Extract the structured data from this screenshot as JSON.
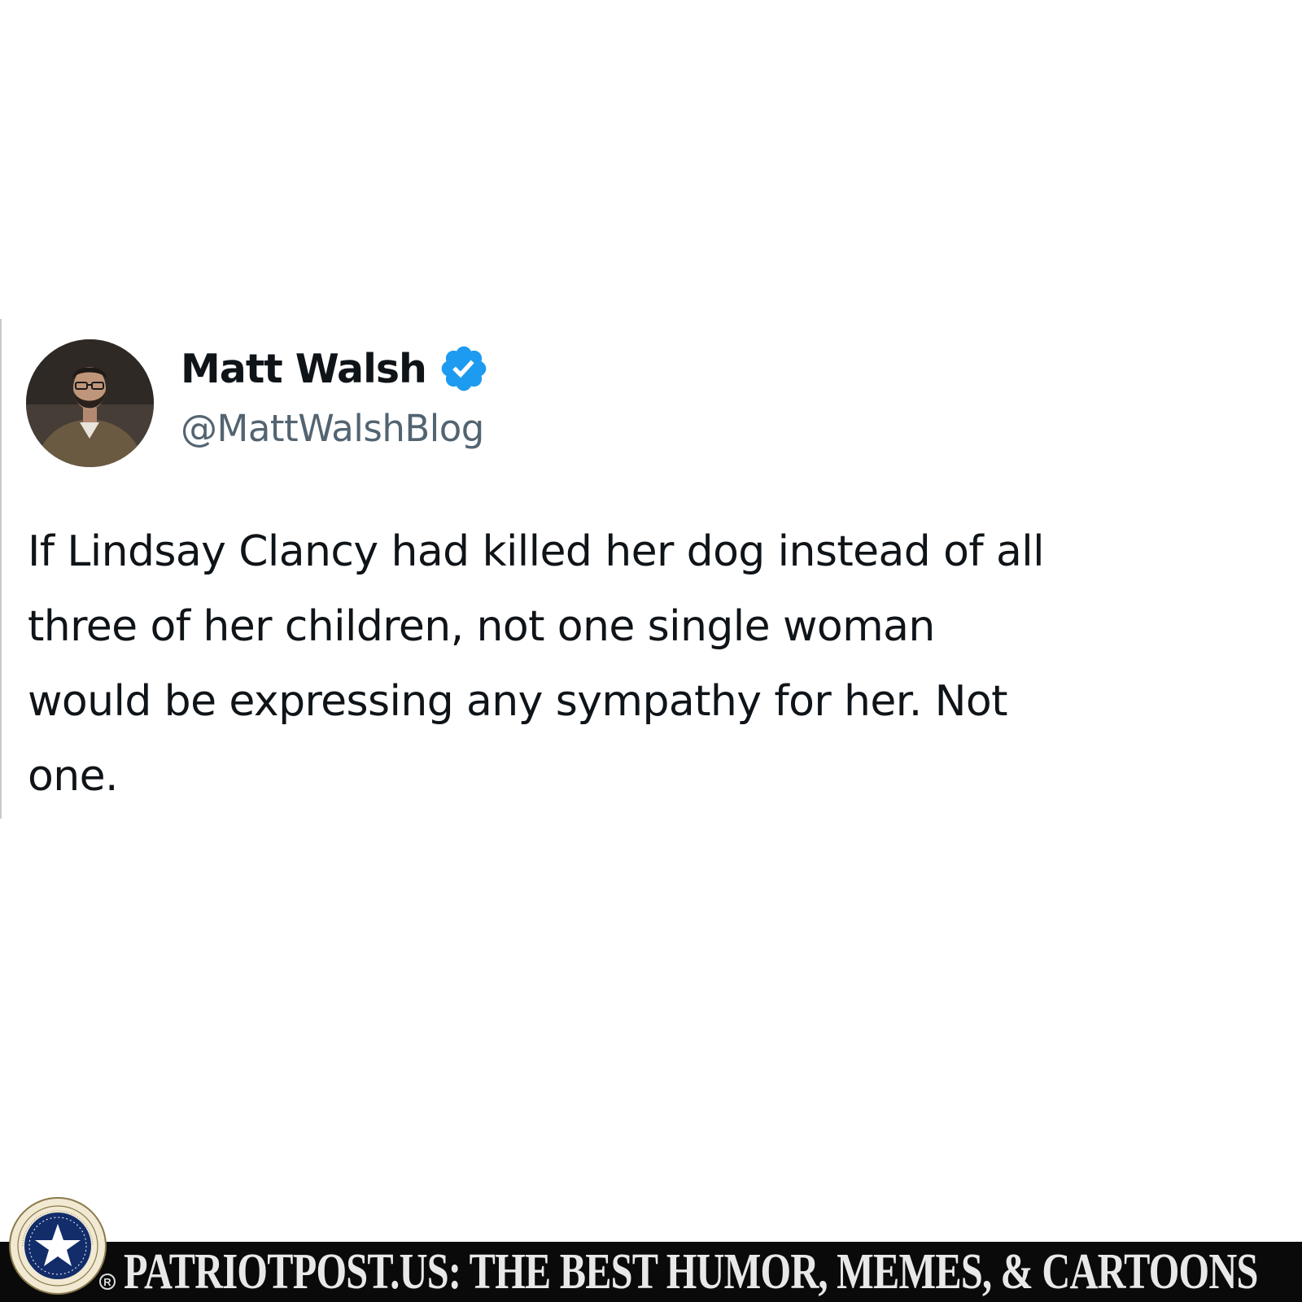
{
  "tweet": {
    "display_name": "Matt Walsh",
    "handle": "@MattWalshBlog",
    "text": "If Lindsay Clancy had killed her dog instead of all\nthree of her children, not one single woman\nwould be expressing any sympathy for her. Not\none.",
    "verified_color": "#1d9bf0"
  },
  "footer": {
    "banner_text": "PATRIOTPOST.US: THE BEST HUMOR, MEMES, & CARTOONS",
    "registered_mark": "R",
    "seal_text": "VERITAS VOS LIBERABIT · SEMPER VIGILANS FORTIS PARATUS ET FIDELIS"
  }
}
